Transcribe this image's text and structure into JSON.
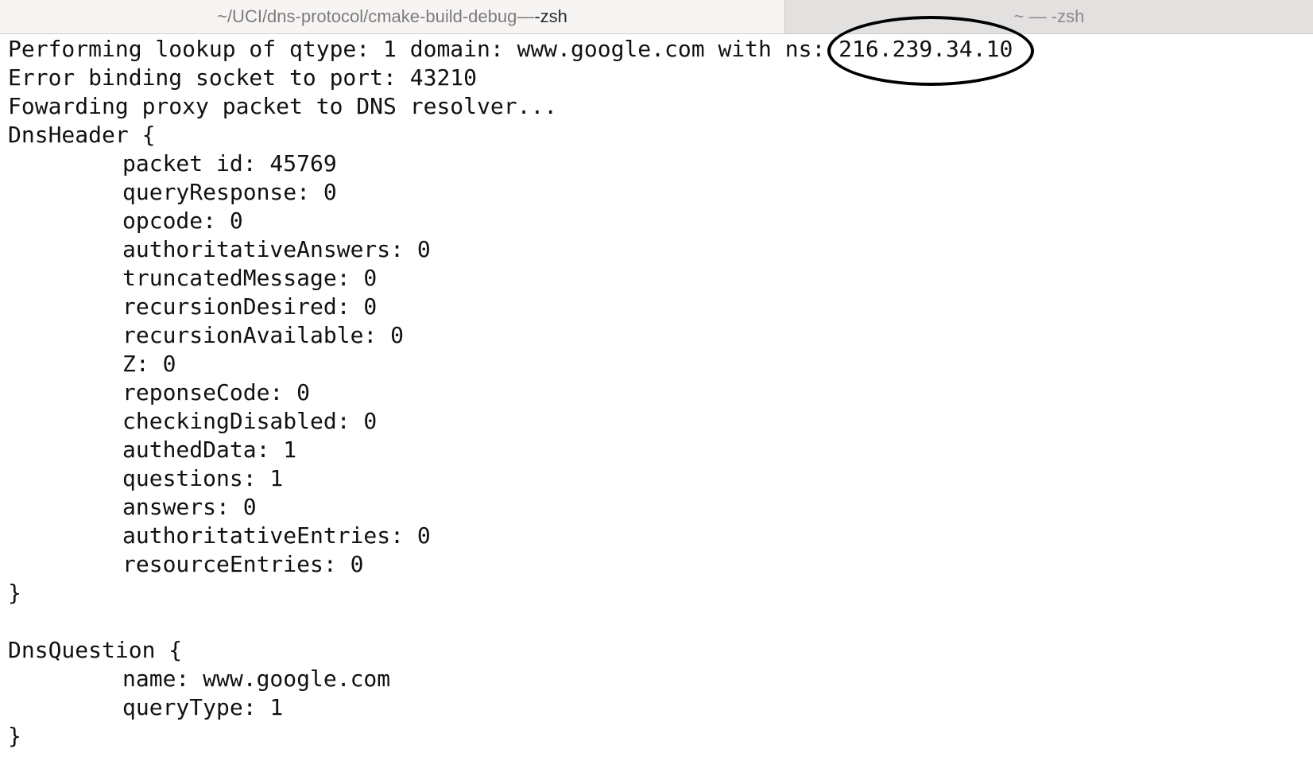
{
  "tabs": [
    {
      "path": "~/UCI/dns-protocol/cmake-build-debug",
      "separator": " — ",
      "command": "-zsh"
    },
    {
      "label": "~ — -zsh"
    }
  ],
  "terminal": {
    "lookup_prefix": "Performing lookup of qtype: 1 domain: www.google.com with ns: ",
    "lookup_ns": "216.239.34.10",
    "error_line": "Error binding socket to port: 43210",
    "forward_line": "Fowarding proxy packet to DNS resolver...",
    "header_open": "DnsHeader {",
    "header_fields": [
      "packet id: 45769",
      "queryResponse: 0",
      "opcode: 0",
      "authoritativeAnswers: 0",
      "truncatedMessage: 0",
      "recursionDesired: 0",
      "recursionAvailable: 0",
      "Z: 0",
      "reponseCode: 0",
      "checkingDisabled: 0",
      "authedData: 1",
      "questions: 1",
      "answers: 0",
      "authoritativeEntries: 0",
      "resourceEntries: 0"
    ],
    "header_close": "}",
    "question_open": "DnsQuestion {",
    "question_fields": [
      "name: www.google.com",
      "queryType: 1"
    ],
    "question_close": "}"
  }
}
